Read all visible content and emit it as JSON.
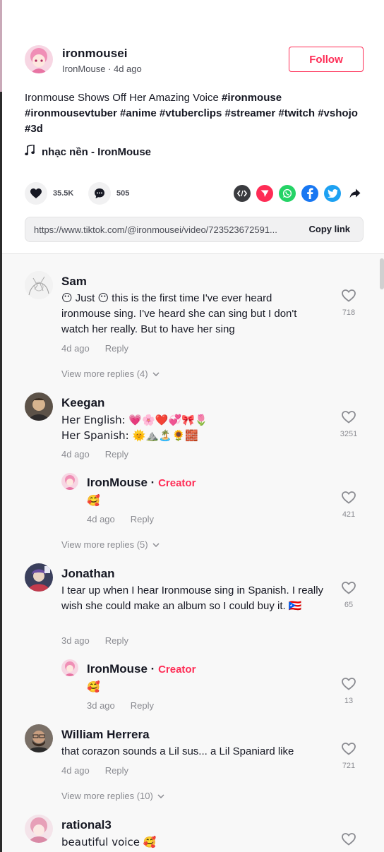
{
  "post": {
    "author_name": "ironmousei",
    "author_display": "IronMouse",
    "time": "4d ago",
    "meta_sep": " · ",
    "follow_label": "Follow",
    "desc_plain": "Ironmouse Shows Off Her Amazing Voice ",
    "hashtags": [
      "#ironmouse",
      "#ironmousevtuber",
      "#anime",
      "#vtuberclips",
      "#streamer",
      "#twitch",
      "#vshojo",
      "#3d"
    ],
    "music": "nhạc nền - IronMouse",
    "likes": "35.5K",
    "comments_count": "505",
    "link": "https://www.tiktok.com/@ironmousei/video/723523672591...",
    "copy_label": "Copy link"
  },
  "comments": [
    {
      "user": "Sam",
      "text": "😶 Just 😶 this is the first time I've ever heard ironmouse sing. I've heard she can sing but I don't watch her really. But to have her sing",
      "time": "4d ago",
      "reply": "Reply",
      "likes": "718",
      "view_more": "View more replies (4)"
    },
    {
      "user": "Keegan",
      "text": "Her English: 💗🌸❤️💞🎀🌷",
      "text2": "Her Spanish: 🌞⛰️🏝️🌻🧱",
      "time": "4d ago",
      "reply": "Reply",
      "likes": "3251",
      "creator_reply": {
        "user": "IronMouse",
        "tag": "Creator",
        "text": "🥰",
        "time": "4d ago",
        "reply": "Reply",
        "likes": "421"
      },
      "view_more": "View more replies (5)"
    },
    {
      "user": "Jonathan",
      "text": "I tear up when I hear Ironmouse sing in Spanish. I really wish she could make an album so I could buy it. 🇵🇷",
      "time": "3d ago",
      "reply": "Reply",
      "likes": "65",
      "creator_reply": {
        "user": "IronMouse",
        "tag": "Creator",
        "text": "🥰",
        "time": "3d ago",
        "reply": "Reply",
        "likes": "13"
      }
    },
    {
      "user": "William Herrera",
      "text": "that corazon sounds a Lil sus... a Lil Spaniard like",
      "time": "4d ago",
      "reply": "Reply",
      "likes": "721",
      "view_more": "View more replies (10)"
    },
    {
      "user": "rational3",
      "text": "beautiful voice 🥰"
    }
  ],
  "colors": {
    "accent": "#fe2c55",
    "text": "#161823",
    "muted": "#8a8b91",
    "comments_bg": "#f8f8f8",
    "facebook": "#1877f2",
    "twitter": "#1da1f2",
    "whatsapp": "#25d366",
    "embed": "#3a3b3f",
    "send": "#fe2c55"
  },
  "icons": [
    "music-note-icon",
    "heart-icon",
    "comment-icon",
    "embed-icon",
    "send-icon",
    "whatsapp-icon",
    "facebook-icon",
    "twitter-icon",
    "share-arrow-icon",
    "chevron-down-icon"
  ]
}
